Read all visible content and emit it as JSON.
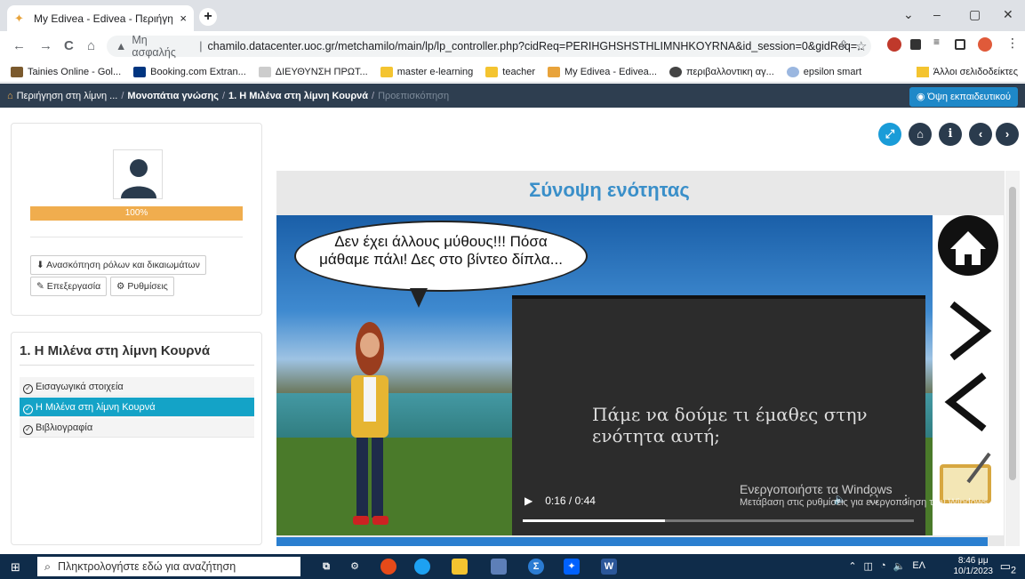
{
  "browser": {
    "tab_title": "My Edivea - Edivea - Περιήγηση",
    "tab_close": "×",
    "new_tab": "+",
    "address_insecure": "Μη ασφαλής",
    "address_url": "chamilo.datacenter.uoc.gr/metchamilo/main/lp/lp_controller.php?cidReq=PERIHGHSHSTHLIMNHKOYRNA&id_session=0&gidReq=...",
    "window_min": "–",
    "window_max": "▢",
    "window_close": "✕"
  },
  "bookmarks": {
    "items": [
      "Tainies Online - Gol...",
      "Booking.com Extran...",
      "ΔΙΕΥΘΥΝΣΗ ΠΡΩΤ...",
      "master e-learning",
      "teacher",
      "My Edivea - Edivea...",
      "περιβαλλοντικη αγ...",
      "epsilon smart"
    ],
    "other": "Άλλοι σελιδοδείκτες"
  },
  "lp_header": {
    "crumb1": "Περιήγηση στη λίμνη ...",
    "crumb2": "Μονοπάτια γνώσης",
    "crumb3": "1. Η Μιλένα στη λίμνη Κουρνά",
    "crumb4": "Προεπισκόπηση",
    "sep": "/",
    "teacher_view": "◉ Όψη εκπαιδευτικού"
  },
  "user_panel": {
    "progress_label": "100%",
    "progress_value": 1.0,
    "roles_button": "⬇ Ανασκόπηση ρόλων και δικαιωμάτων",
    "edit_button": "✎ Επεξεργασία",
    "settings_button": "⚙ Ρυθμίσεις"
  },
  "lp_panel": {
    "title": "1. Η Μιλένα στη λίμνη Κουρνά",
    "items": [
      {
        "label": "Εισαγωγικά στοιχεία",
        "active": false
      },
      {
        "label": "Η Μιλένα στη λίμνη Κουρνά",
        "active": true
      },
      {
        "label": "Βιβλιογραφία",
        "active": false
      }
    ]
  },
  "content": {
    "title": "Σύνοψη ενότητας",
    "bubble_text": "Δεν έχει άλλους μύθους!!! Πόσα μάθαμε πάλι! Δες στο βίντεο δίπλα...",
    "video_text": "Πάμε να δούμε τι έμαθες στην ενότητα αυτή;",
    "video_time": "0:16 / 0:44",
    "video_progress": 0.364
  },
  "watermark": {
    "line1": "Ενεργοποιήστε τα Windows",
    "line2": "Μετάβαση στις ρυθμίσεις για ενεργοποίηση των Windows."
  },
  "taskbar": {
    "search_placeholder": "Πληκτρολογήστε εδώ για αναζήτηση",
    "lang": "ΕΛ",
    "time": "8:46 μμ",
    "date": "10/1/2023",
    "notif_count": "2"
  },
  "colors": {
    "header_bg": "#2e3e50",
    "accent_blue": "#1a9cd8",
    "active_item": "#14a3c7",
    "progress": "#f0ad4e",
    "title_blue": "#3a8fc9"
  }
}
